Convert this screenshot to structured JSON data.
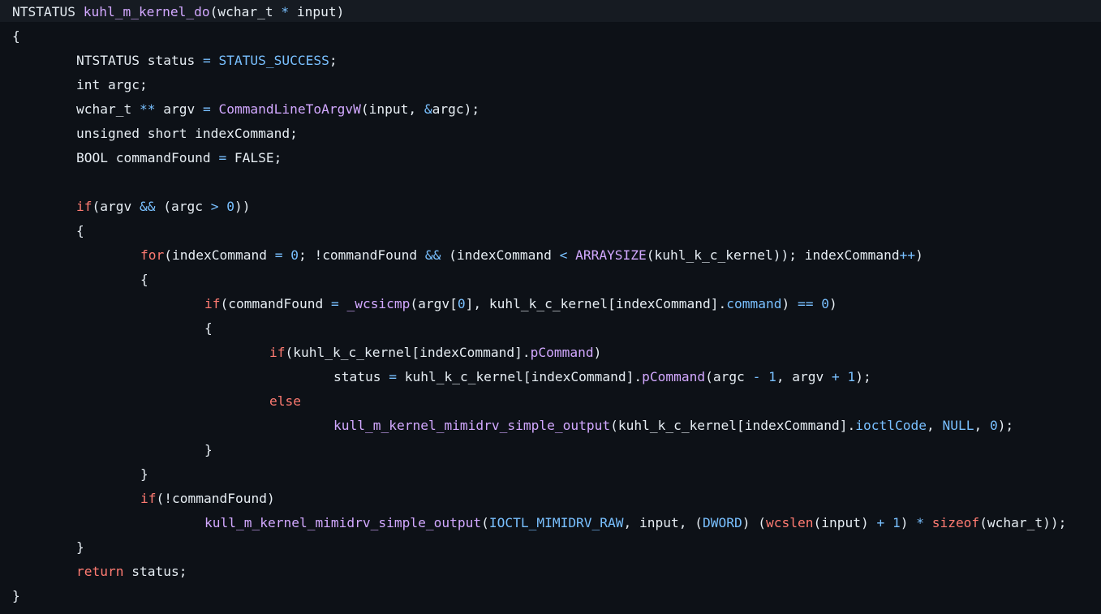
{
  "theme": {
    "background": "#0d1117",
    "header_background": "#161b22",
    "text": "#e6edf3",
    "keyword": "#ff7b72",
    "function": "#d2a8ff",
    "constant": "#79c0ff"
  },
  "code": {
    "language": "c",
    "lines": [
      [
        {
          "t": "NTSTATUS ",
          "c": "plain"
        },
        {
          "t": "kuhl_m_kernel_do",
          "c": "fn"
        },
        {
          "t": "(wchar_t ",
          "c": "plain"
        },
        {
          "t": "*",
          "c": "const"
        },
        {
          "t": " input)",
          "c": "plain"
        }
      ],
      [
        {
          "t": "{",
          "c": "plain"
        }
      ],
      [
        {
          "t": "NTSTATUS status ",
          "c": "plain"
        },
        {
          "t": "=",
          "c": "const"
        },
        {
          "t": " ",
          "c": "plain"
        },
        {
          "t": "STATUS_SUCCESS",
          "c": "const"
        },
        {
          "t": ";",
          "c": "plain"
        }
      ],
      [
        {
          "t": "int argc;",
          "c": "plain"
        }
      ],
      [
        {
          "t": "wchar_t ",
          "c": "plain"
        },
        {
          "t": "**",
          "c": "const"
        },
        {
          "t": " argv ",
          "c": "plain"
        },
        {
          "t": "=",
          "c": "const"
        },
        {
          "t": " ",
          "c": "plain"
        },
        {
          "t": "CommandLineToArgvW",
          "c": "fn"
        },
        {
          "t": "(input, ",
          "c": "plain"
        },
        {
          "t": "&",
          "c": "const"
        },
        {
          "t": "argc);",
          "c": "plain"
        }
      ],
      [
        {
          "t": "unsigned short indexCommand;",
          "c": "plain"
        }
      ],
      [
        {
          "t": "BOOL commandFound ",
          "c": "plain"
        },
        {
          "t": "=",
          "c": "const"
        },
        {
          "t": " FALSE;",
          "c": "plain"
        }
      ],
      [],
      [
        {
          "t": "if",
          "c": "kw"
        },
        {
          "t": "(argv ",
          "c": "plain"
        },
        {
          "t": "&&",
          "c": "const"
        },
        {
          "t": " (argc ",
          "c": "plain"
        },
        {
          "t": ">",
          "c": "const"
        },
        {
          "t": " ",
          "c": "plain"
        },
        {
          "t": "0",
          "c": "const"
        },
        {
          "t": "))",
          "c": "plain"
        }
      ],
      [
        {
          "t": "{",
          "c": "plain"
        }
      ],
      [
        {
          "t": "for",
          "c": "kw"
        },
        {
          "t": "(indexCommand ",
          "c": "plain"
        },
        {
          "t": "=",
          "c": "const"
        },
        {
          "t": " ",
          "c": "plain"
        },
        {
          "t": "0",
          "c": "const"
        },
        {
          "t": "; !commandFound ",
          "c": "plain"
        },
        {
          "t": "&&",
          "c": "const"
        },
        {
          "t": " (indexCommand ",
          "c": "plain"
        },
        {
          "t": "<",
          "c": "const"
        },
        {
          "t": " ",
          "c": "plain"
        },
        {
          "t": "ARRAYSIZE",
          "c": "fn"
        },
        {
          "t": "(kuhl_k_c_kernel)); indexCommand",
          "c": "plain"
        },
        {
          "t": "++",
          "c": "const"
        },
        {
          "t": ")",
          "c": "plain"
        }
      ],
      [
        {
          "t": "{",
          "c": "plain"
        }
      ],
      [
        {
          "t": "if",
          "c": "kw"
        },
        {
          "t": "(commandFound ",
          "c": "plain"
        },
        {
          "t": "=",
          "c": "const"
        },
        {
          "t": " ",
          "c": "plain"
        },
        {
          "t": "_wcsicmp",
          "c": "fn"
        },
        {
          "t": "(argv[",
          "c": "plain"
        },
        {
          "t": "0",
          "c": "const"
        },
        {
          "t": "], kuhl_k_c_kernel[indexCommand].",
          "c": "plain"
        },
        {
          "t": "command",
          "c": "const"
        },
        {
          "t": ") ",
          "c": "plain"
        },
        {
          "t": "==",
          "c": "const"
        },
        {
          "t": " ",
          "c": "plain"
        },
        {
          "t": "0",
          "c": "const"
        },
        {
          "t": ")",
          "c": "plain"
        }
      ],
      [
        {
          "t": "{",
          "c": "plain"
        }
      ],
      [
        {
          "t": "if",
          "c": "kw"
        },
        {
          "t": "(kuhl_k_c_kernel[indexCommand].",
          "c": "plain"
        },
        {
          "t": "pCommand",
          "c": "fn"
        },
        {
          "t": ")",
          "c": "plain"
        }
      ],
      [
        {
          "t": "status ",
          "c": "plain"
        },
        {
          "t": "=",
          "c": "const"
        },
        {
          "t": " kuhl_k_c_kernel[indexCommand].",
          "c": "plain"
        },
        {
          "t": "pCommand",
          "c": "fn"
        },
        {
          "t": "(argc ",
          "c": "plain"
        },
        {
          "t": "-",
          "c": "const"
        },
        {
          "t": " ",
          "c": "plain"
        },
        {
          "t": "1",
          "c": "const"
        },
        {
          "t": ", argv ",
          "c": "plain"
        },
        {
          "t": "+",
          "c": "const"
        },
        {
          "t": " ",
          "c": "plain"
        },
        {
          "t": "1",
          "c": "const"
        },
        {
          "t": ");",
          "c": "plain"
        }
      ],
      [
        {
          "t": "else",
          "c": "kw"
        }
      ],
      [
        {
          "t": "kull_m_kernel_mimidrv_simple_output",
          "c": "fn"
        },
        {
          "t": "(kuhl_k_c_kernel[indexCommand].",
          "c": "plain"
        },
        {
          "t": "ioctlCode",
          "c": "const"
        },
        {
          "t": ", ",
          "c": "plain"
        },
        {
          "t": "NULL",
          "c": "const"
        },
        {
          "t": ", ",
          "c": "plain"
        },
        {
          "t": "0",
          "c": "const"
        },
        {
          "t": ");",
          "c": "plain"
        }
      ],
      [
        {
          "t": "}",
          "c": "plain"
        }
      ],
      [
        {
          "t": "}",
          "c": "plain"
        }
      ],
      [
        {
          "t": "if",
          "c": "kw"
        },
        {
          "t": "(!commandFound)",
          "c": "plain"
        }
      ],
      [
        {
          "t": "kull_m_kernel_mimidrv_simple_output",
          "c": "fn"
        },
        {
          "t": "(",
          "c": "plain"
        },
        {
          "t": "IOCTL_MIMIDRV_RAW",
          "c": "const"
        },
        {
          "t": ", input, (",
          "c": "plain"
        },
        {
          "t": "DWORD",
          "c": "const"
        },
        {
          "t": ") (",
          "c": "plain"
        },
        {
          "t": "wcslen",
          "c": "kw"
        },
        {
          "t": "(input) ",
          "c": "plain"
        },
        {
          "t": "+",
          "c": "const"
        },
        {
          "t": " ",
          "c": "plain"
        },
        {
          "t": "1",
          "c": "const"
        },
        {
          "t": ") ",
          "c": "plain"
        },
        {
          "t": "*",
          "c": "const"
        },
        {
          "t": " ",
          "c": "plain"
        },
        {
          "t": "sizeof",
          "c": "kw"
        },
        {
          "t": "(wchar_t));",
          "c": "plain"
        }
      ],
      [
        {
          "t": "}",
          "c": "plain"
        }
      ],
      [
        {
          "t": "return",
          "c": "kw"
        },
        {
          "t": " status;",
          "c": "plain"
        }
      ],
      [
        {
          "t": "}",
          "c": "plain"
        }
      ]
    ]
  }
}
